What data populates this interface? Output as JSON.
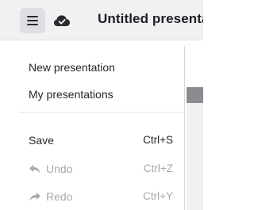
{
  "header": {
    "title": "Untitled presentation",
    "icons": {
      "menu": "hamburger-menu-icon",
      "cloud": "cloud-saved-icon"
    }
  },
  "menu": {
    "items": [
      {
        "label": "New presentation",
        "shortcut": "",
        "enabled": true
      },
      {
        "label": "My presentations",
        "shortcut": "",
        "enabled": true
      },
      {
        "label": "Save",
        "shortcut": "Ctrl+S",
        "enabled": true
      },
      {
        "label": "Undo",
        "shortcut": "Ctrl+Z",
        "enabled": false,
        "icon": "undo-icon"
      },
      {
        "label": "Redo",
        "shortcut": "Ctrl+Y",
        "enabled": false,
        "icon": "redo-icon"
      }
    ]
  },
  "colors": {
    "topbar": "#f1f1f3",
    "text": "#26262a",
    "disabled_text": "#a8a8ae"
  }
}
